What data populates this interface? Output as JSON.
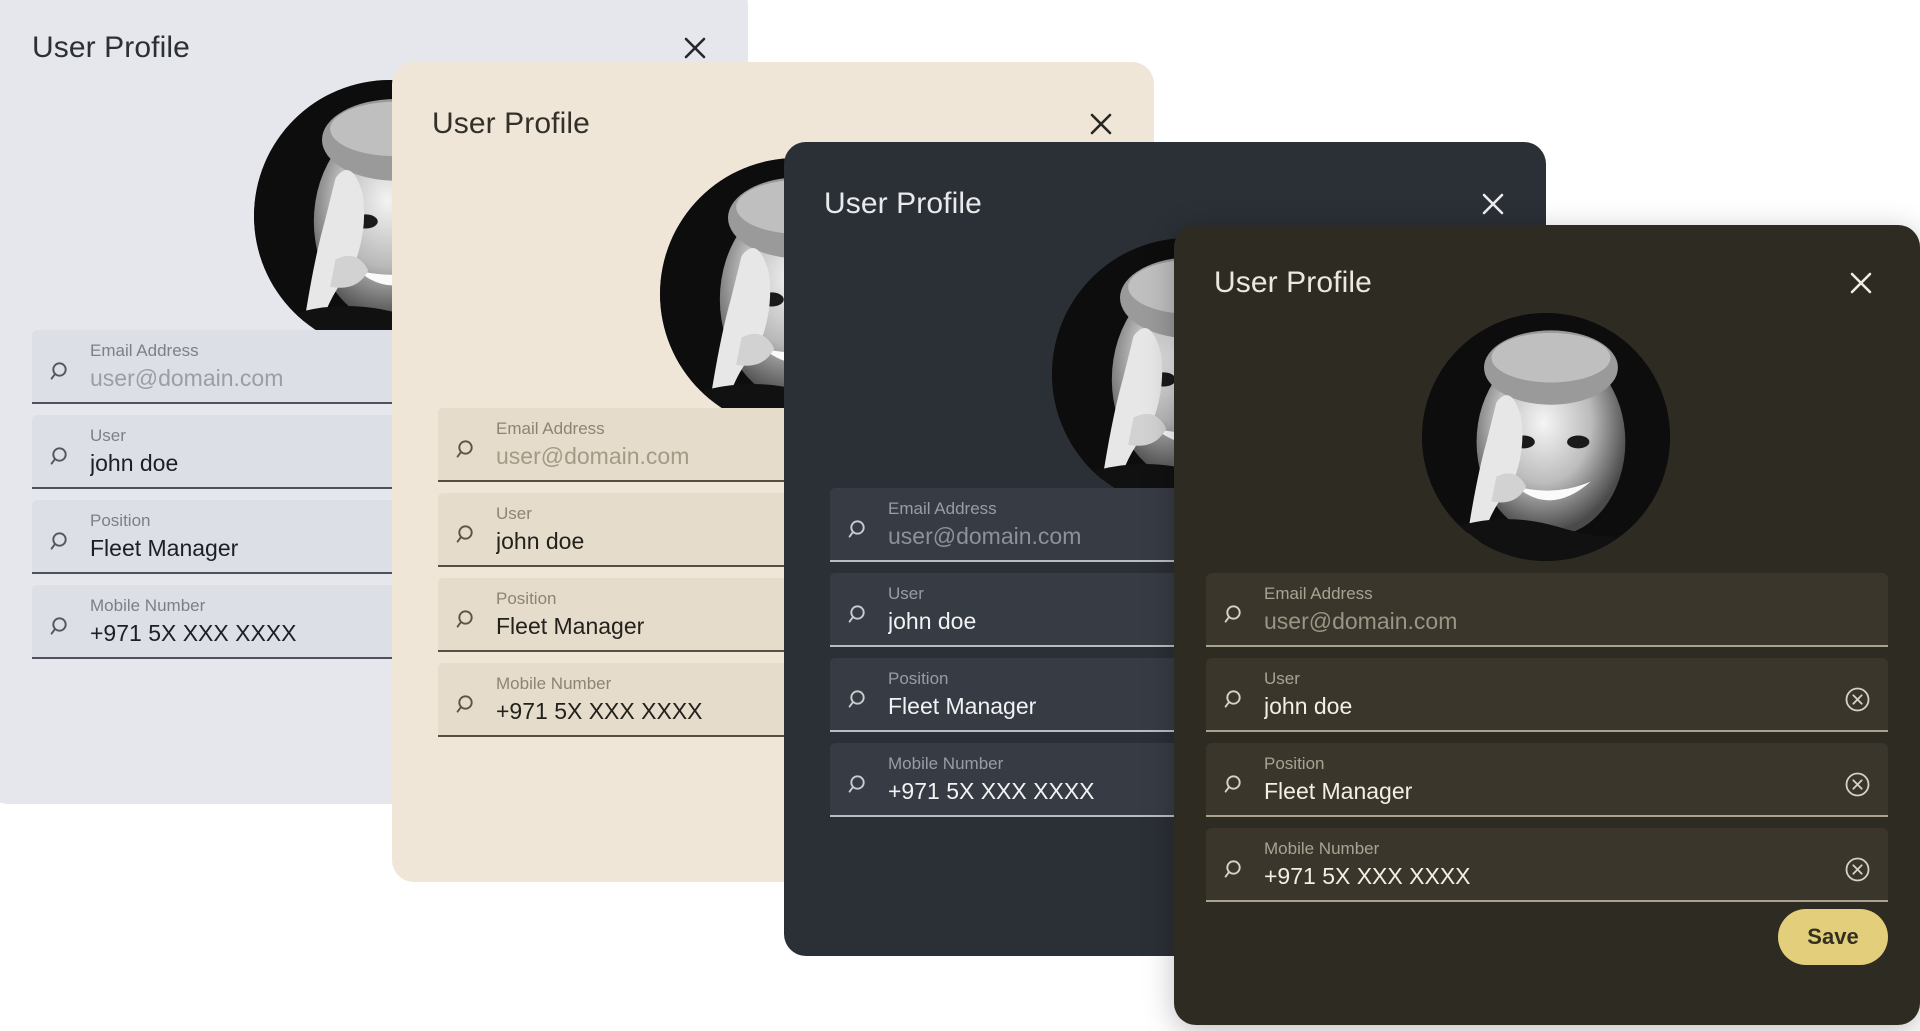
{
  "cards": [
    {
      "title": "User Profile",
      "theme": "light-grey",
      "background": "#e5e7ec",
      "close_icon": "close-icon",
      "avatar": {
        "icon": "avatar",
        "alt": "user portrait"
      },
      "fields": [
        {
          "label": "Email Address",
          "value": "user@domain.com",
          "is_placeholder": true,
          "icon": "search-icon",
          "clear_icon": null
        },
        {
          "label": "User",
          "value": "john doe",
          "is_placeholder": false,
          "icon": "search-icon",
          "clear_icon": null
        },
        {
          "label": "Position",
          "value": "Fleet Manager",
          "is_placeholder": false,
          "icon": "search-icon",
          "clear_icon": null
        },
        {
          "label": "Mobile Number",
          "value": "+971 5X XXX XXXX",
          "is_placeholder": false,
          "icon": "search-icon",
          "clear_icon": null
        }
      ],
      "save_label": null
    },
    {
      "title": "User Profile",
      "theme": "beige",
      "background": "#efe6d8",
      "close_icon": "close-icon",
      "avatar": {
        "icon": "avatar",
        "alt": "user portrait"
      },
      "fields": [
        {
          "label": "Email Address",
          "value": "user@domain.com",
          "is_placeholder": true,
          "icon": "search-icon",
          "clear_icon": null
        },
        {
          "label": "User",
          "value": "john doe",
          "is_placeholder": false,
          "icon": "search-icon",
          "clear_icon": null
        },
        {
          "label": "Position",
          "value": "Fleet Manager",
          "is_placeholder": false,
          "icon": "search-icon",
          "clear_icon": null
        },
        {
          "label": "Mobile Number",
          "value": "+971 5X XXX XXXX",
          "is_placeholder": false,
          "icon": "search-icon",
          "clear_icon": null
        }
      ],
      "save_label": null
    },
    {
      "title": "User Profile",
      "theme": "dark-slate",
      "background": "#2b2f36",
      "close_icon": "close-icon",
      "avatar": {
        "icon": "avatar",
        "alt": "user portrait"
      },
      "fields": [
        {
          "label": "Email Address",
          "value": "user@domain.com",
          "is_placeholder": true,
          "icon": "search-icon",
          "clear_icon": null
        },
        {
          "label": "User",
          "value": "john doe",
          "is_placeholder": false,
          "icon": "search-icon",
          "clear_icon": null
        },
        {
          "label": "Position",
          "value": "Fleet Manager",
          "is_placeholder": false,
          "icon": "search-icon",
          "clear_icon": null
        },
        {
          "label": "Mobile Number",
          "value": "+971 5X XXX XXXX",
          "is_placeholder": false,
          "icon": "search-icon",
          "clear_icon": null
        }
      ],
      "save_label": null
    },
    {
      "title": "User Profile",
      "theme": "dark-olive",
      "background": "#2e2b22",
      "accent": "#e3ce7c",
      "close_icon": "close-icon",
      "avatar": {
        "icon": "avatar",
        "alt": "user portrait"
      },
      "fields": [
        {
          "label": "Email Address",
          "value": "user@domain.com",
          "is_placeholder": true,
          "icon": "search-icon",
          "clear_icon": null
        },
        {
          "label": "User",
          "value": "john doe",
          "is_placeholder": false,
          "icon": "search-icon",
          "clear_icon": "clear-circle-icon"
        },
        {
          "label": "Position",
          "value": "Fleet Manager",
          "is_placeholder": false,
          "icon": "search-icon",
          "clear_icon": "clear-circle-icon"
        },
        {
          "label": "Mobile Number",
          "value": "+971 5X XXX XXXX",
          "is_placeholder": false,
          "icon": "search-icon",
          "clear_icon": "clear-circle-icon"
        }
      ],
      "save_label": "Save"
    }
  ]
}
